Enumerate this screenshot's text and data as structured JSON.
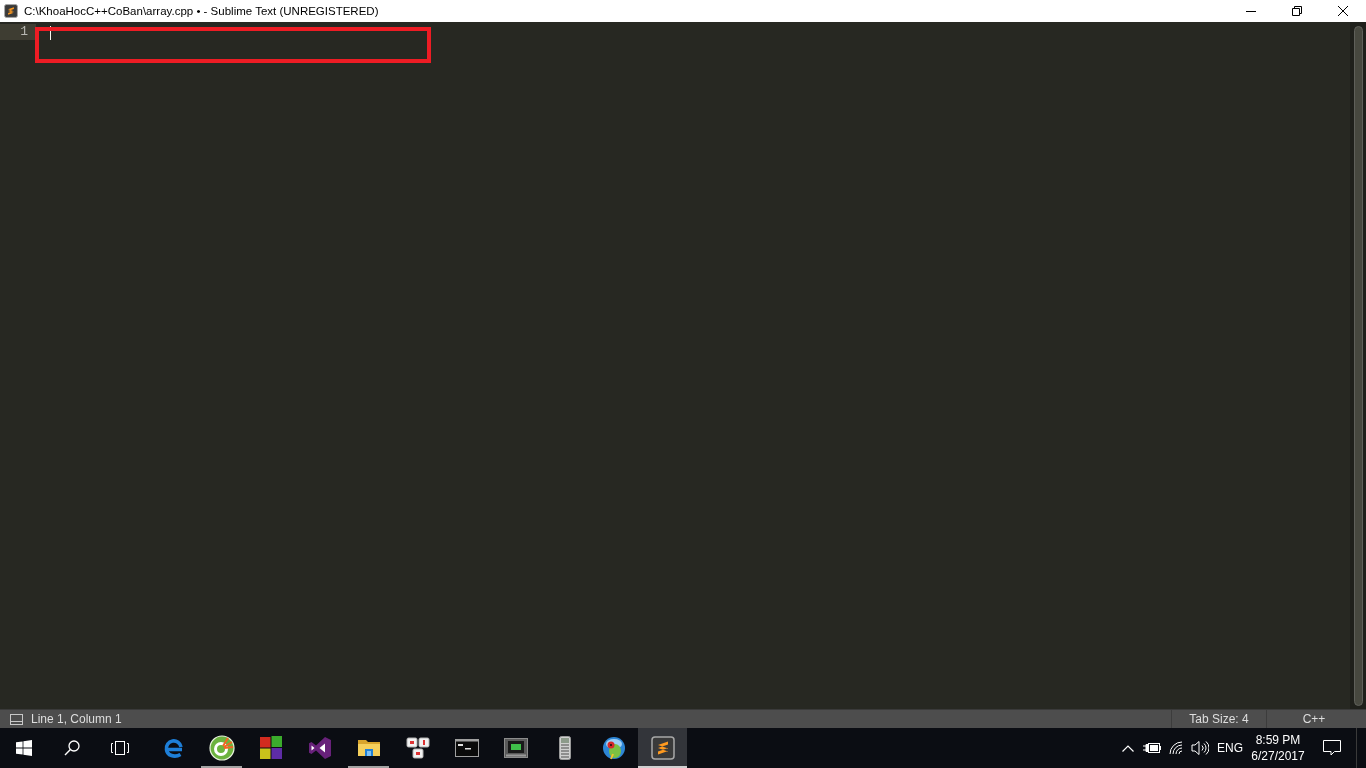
{
  "window": {
    "title": "C:\\KhoaHocC++CoBan\\array.cpp • - Sublime Text (UNREGISTERED)"
  },
  "editor": {
    "lines": [
      {
        "number": "1",
        "current": true
      }
    ]
  },
  "status_bar": {
    "position": "Line 1, Column 1",
    "tab_size": "Tab Size: 4",
    "syntax": "C++"
  },
  "taskbar": {
    "apps": [
      {
        "kind": "browser",
        "running": false,
        "selected": false
      },
      {
        "kind": "reader",
        "running": true,
        "selected": false
      },
      {
        "kind": "squares",
        "running": false,
        "selected": false
      },
      {
        "kind": "studio",
        "running": false,
        "selected": false
      },
      {
        "kind": "folder",
        "running": true,
        "selected": false
      },
      {
        "kind": "keys",
        "running": false,
        "selected": false
      },
      {
        "kind": "console",
        "running": false,
        "selected": false
      },
      {
        "kind": "terminal",
        "running": false,
        "selected": false
      },
      {
        "kind": "calculator",
        "running": false,
        "selected": false
      },
      {
        "kind": "parrot",
        "running": false,
        "selected": false
      },
      {
        "kind": "editor",
        "running": true,
        "selected": true
      }
    ],
    "tray": {
      "language": "ENG",
      "time": "8:59 PM",
      "date": "6/27/2017"
    }
  }
}
